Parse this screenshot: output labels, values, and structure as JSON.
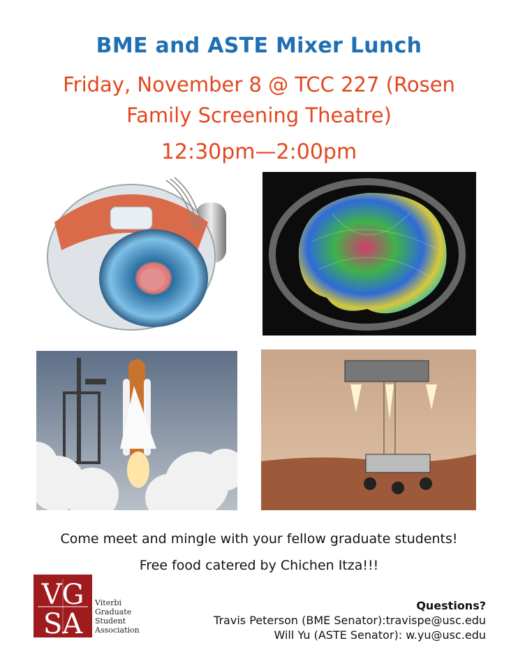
{
  "header": {
    "title": "BME and ASTE Mixer Lunch",
    "line1": "Friday, November 8 @ TCC 227 (Rosen",
    "line2": "Family Screening Theatre)",
    "time": "12:30pm—2:00pm"
  },
  "body": {
    "line1": "Come meet and mingle with your fellow graduate students!",
    "line2": "Free food catered by Chichen Itza!!!"
  },
  "logo": {
    "mark": "VGSA",
    "words": [
      "Viterbi",
      "Graduate",
      "Student",
      "Association"
    ]
  },
  "contact": {
    "heading": "Questions?",
    "line1": "Travis Peterson (BME Senator):travispe@usc.edu",
    "line2": "Will Yu (ASTE Senator): w.yu@usc.edu"
  },
  "colors": {
    "title": "#1f6fb3",
    "accent": "#e2471f",
    "logo": "#9e1b1e"
  }
}
